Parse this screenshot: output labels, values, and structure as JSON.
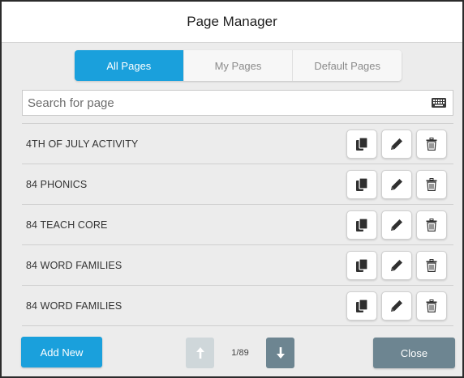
{
  "dialog": {
    "title": "Page Manager"
  },
  "tabs": [
    {
      "label": "All Pages",
      "active": true
    },
    {
      "label": "My Pages",
      "active": false
    },
    {
      "label": "Default Pages",
      "active": false
    }
  ],
  "search": {
    "placeholder": "Search for page",
    "value": "",
    "icon": "keyboard-icon"
  },
  "pages": [
    {
      "label": "4TH OF JULY ACTIVITY"
    },
    {
      "label": "84 PHONICS"
    },
    {
      "label": "84 TEACH CORE"
    },
    {
      "label": "84 WORD FAMILIES"
    },
    {
      "label": "84 WORD FAMILIES"
    }
  ],
  "row_actions": {
    "copy_icon": "copy-icon",
    "edit_icon": "pencil-icon",
    "delete_icon": "trash-icon"
  },
  "footer": {
    "add_label": "Add New",
    "page_indicator": "1/89",
    "close_label": "Close"
  },
  "colors": {
    "accent": "#1aa0dc",
    "secondary": "#6d8591",
    "disabled": "#cfd7da"
  }
}
